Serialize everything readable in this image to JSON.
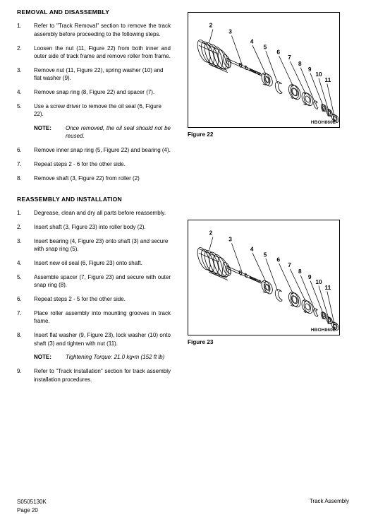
{
  "document": {
    "sections": [
      {
        "id": "removal",
        "heading": "REMOVAL AND DISASSEMBLY",
        "items": [
          {
            "type": "step",
            "num": "1.",
            "text": "Refer to \"Track Removal\" section to remove the track assembly before proceeding to the following steps."
          },
          {
            "type": "step",
            "num": "2.",
            "text": "Loosen the nut (11, Figure 22) from both inner and outer side of track frame and remove roller from frame."
          },
          {
            "type": "step",
            "num": "3.",
            "text": "Remove nut (11, Figure 22), spring washer (10) and flat washer (9)."
          },
          {
            "type": "step",
            "num": "4.",
            "text": "Remove snap ring (8, Figure 22) and spacer (7)."
          },
          {
            "type": "step",
            "num": "5.",
            "text": "Use a screw driver to remove the oil seal (6, Figure 22)."
          },
          {
            "type": "note",
            "label": "NOTE:",
            "text": "Once removed, the oil seal should not be reused."
          },
          {
            "type": "step",
            "num": "6.",
            "text": "Remove inner snap ring (5, Figure 22) and bearing (4)."
          },
          {
            "type": "step",
            "num": "7.",
            "text": "Repeat steps 2 - 6 for the other side."
          },
          {
            "type": "step",
            "num": "8.",
            "text": "Remove shaft (3, Figure 22) from roller (2)"
          }
        ]
      },
      {
        "id": "reassembly",
        "heading": "REASSEMBLY AND INSTALLATION",
        "items": [
          {
            "type": "step",
            "num": "1.",
            "text": "Degrease, clean and dry all parts before reassembly."
          },
          {
            "type": "step",
            "num": "2.",
            "text": "Insert shaft (3, Figure 23) into roller body (2)."
          },
          {
            "type": "step",
            "num": "3.",
            "text": "Insert bearing (4, Figure 23) onto shaft (3) and secure with snap ring (5)."
          },
          {
            "type": "step",
            "num": "4.",
            "text": "Insert new oil seal (6, Figure 23) onto shaft."
          },
          {
            "type": "step",
            "num": "5.",
            "text": "Assemble spacer (7, Figure 23) and secure with outer snap ring (8)."
          },
          {
            "type": "step",
            "num": "6.",
            "text": "Repeat steps 2 - 5 for the other side."
          },
          {
            "type": "step",
            "num": "7.",
            "text": "Place roller assembly into mounting grooves in track frame."
          },
          {
            "type": "step",
            "num": "8.",
            "text": "Insert flat washer (9, Figure 23), lock washer (10) onto shaft (3) and tighten with nut (11)."
          },
          {
            "type": "note",
            "label": "NOTE:",
            "text": "Tightening Torque: 21.0 kg•m (152 ft lb)"
          },
          {
            "type": "step",
            "num": "9.",
            "text": "Refer to \"Track Installation\" section for track assembly installation procedures."
          }
        ]
      }
    ],
    "figures": [
      {
        "id": "figure-22",
        "caption": "Figure 22",
        "code": "HBOH860L",
        "callouts": [
          "2",
          "3",
          "4",
          "5",
          "6",
          "7",
          "8",
          "9",
          "10",
          "11"
        ]
      },
      {
        "id": "figure-23",
        "caption": "Figure 23",
        "code": "HBOH860L",
        "callouts": [
          "2",
          "3",
          "4",
          "5",
          "6",
          "7",
          "8",
          "9",
          "10",
          "11"
        ]
      }
    ],
    "footer": {
      "doc_number": "S0505130K",
      "page_label": "Page 20",
      "section_title": "Track Assembly"
    }
  }
}
